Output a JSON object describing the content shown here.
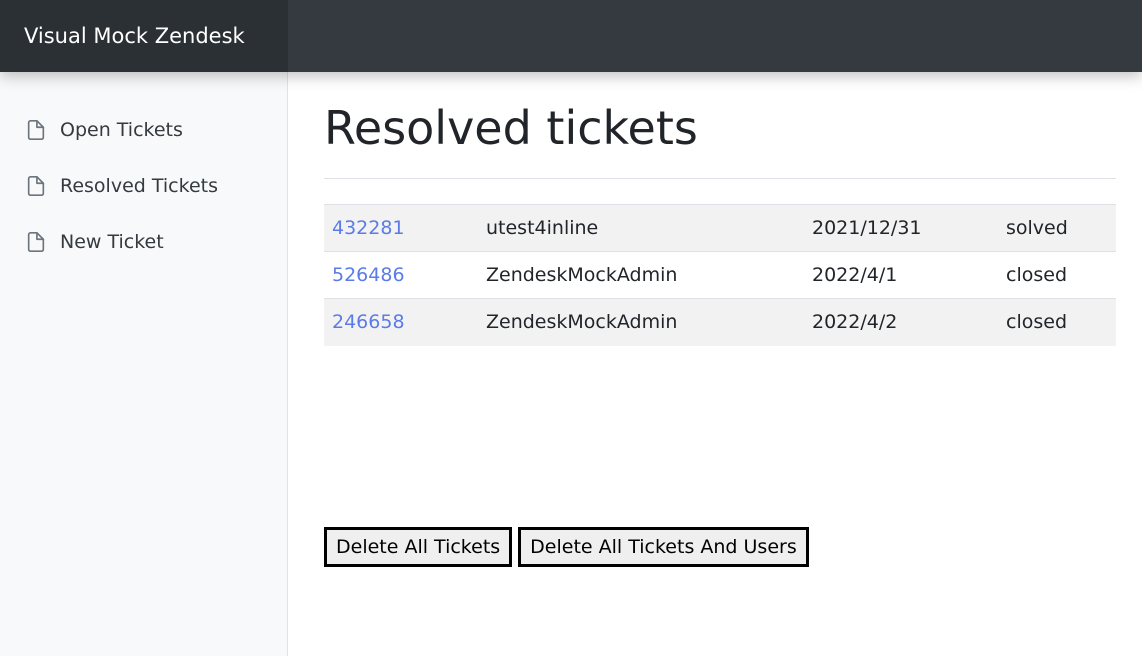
{
  "app": {
    "brand": "Visual Mock Zendesk"
  },
  "sidebar": {
    "items": [
      {
        "label": "Open Tickets",
        "icon": "file-icon"
      },
      {
        "label": "Resolved Tickets",
        "icon": "file-icon"
      },
      {
        "label": "New Ticket",
        "icon": "file-icon"
      }
    ]
  },
  "main": {
    "title": "Resolved tickets",
    "tickets": [
      {
        "id": "432281",
        "requester": "utest4inline",
        "date": "2021/12/31",
        "status": "solved"
      },
      {
        "id": "526486",
        "requester": "ZendeskMockAdmin",
        "date": "2022/4/1",
        "status": "closed"
      },
      {
        "id": "246658",
        "requester": "ZendeskMockAdmin",
        "date": "2022/4/2",
        "status": "closed"
      }
    ]
  },
  "actions": {
    "delete_tickets": "Delete All Tickets",
    "delete_tickets_users": "Delete All Tickets And Users"
  },
  "colors": {
    "topbar": "#343a40",
    "brand_bg": "#2b3035",
    "link": "#5b7be8",
    "sidebar": "#f8f9fa"
  }
}
